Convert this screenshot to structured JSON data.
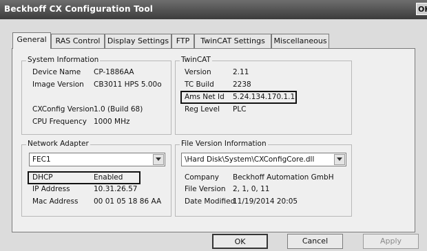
{
  "window": {
    "title": "Beckhoff CX Configuration Tool",
    "title_ok": "OK"
  },
  "tabs": [
    {
      "label": "General",
      "active": true
    },
    {
      "label": "RAS Control"
    },
    {
      "label": "Display Settings"
    },
    {
      "label": "FTP"
    },
    {
      "label": "TwinCAT Settings"
    },
    {
      "label": "Miscellaneous"
    }
  ],
  "system_info": {
    "title": "System Information",
    "device_name_label": "Device Name",
    "device_name": "CP-1886AA",
    "image_version_label": "Image Version",
    "image_version": "CB3011 HPS 5.00o",
    "cxconfig_version_label": "CXConfig Version",
    "cxconfig_version": "1.0 (Build 68)",
    "cpu_frequency_label": "CPU Frequency",
    "cpu_frequency": "1000 MHz"
  },
  "twincat": {
    "title": "TwinCAT",
    "version_label": "Version",
    "version": "2.11",
    "tc_build_label": "TC Build",
    "tc_build": "2238",
    "ams_net_id_label": "Ams Net Id",
    "ams_net_id": "5.24.134.170.1.1",
    "reg_level_label": "Reg Level",
    "reg_level": "PLC"
  },
  "network_adapter": {
    "title": "Network Adapter",
    "selected": "FEC1",
    "dhcp_label": "DHCP",
    "dhcp": "Enabled",
    "ip_label": "IP Address",
    "ip": "10.31.26.57",
    "mac_label": "Mac Address",
    "mac": "00 01 05 18 86 AA"
  },
  "file_version": {
    "title": "File Version Information",
    "selected": "\\Hard Disk\\System\\CXConfigCore.dll",
    "company_label": "Company",
    "company": "Beckhoff Automation GmbH",
    "file_version_label": "File Version",
    "file_version": "2, 1, 0, 11",
    "date_modified_label": "Date Modified",
    "date_modified": "11/19/2014 20:05"
  },
  "buttons": {
    "ok": "OK",
    "cancel": "Cancel",
    "apply": "Apply"
  },
  "icons": {
    "combo_arrow": "chevron-down-icon"
  }
}
